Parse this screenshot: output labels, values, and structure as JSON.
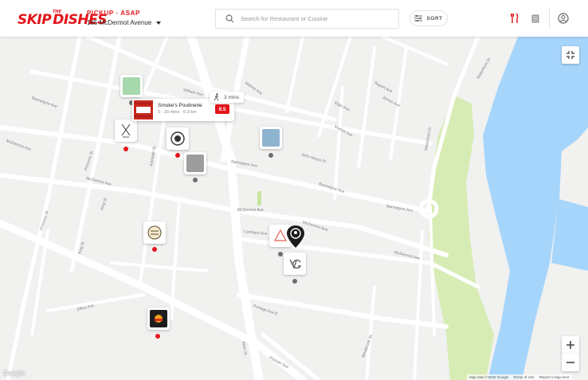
{
  "header": {
    "logo_main": "SKIP",
    "logo_the": "THE",
    "logo_dishes": "DISHES",
    "mode_label": "PICKUP · ASAP",
    "address": "165 McDermot Avenue",
    "search_placeholder": "Search for Restaurant or Cuisine",
    "sort_label": "SORT",
    "brand_color": "#e3151b"
  },
  "map": {
    "streets": {
      "william": "William Ave",
      "market": "Market Ave",
      "elgin": "Elgin Ave",
      "james": "James Ave",
      "bannatyne_left": "Bannatyne Ave",
      "bannatyne_mid": "Bannatyne Ave",
      "bannatyne_right": "Bannatyne Ave",
      "mcdermot_left": "McDermot Ave",
      "mcdermot_mid": "McDermot Ave",
      "mcdermot_right": "McDermot Ave",
      "lombard": "Lombard Ave",
      "portage": "Portage Ave E",
      "pioneer": "Pioneer Ave",
      "ellice": "Ellice Ave",
      "princess": "Princess St",
      "king": "King St",
      "adelaide": "Adelaide St",
      "main": "Main St",
      "waterfront": "Waterfront Dr",
      "rupert": "Rupert Ave",
      "john_hirsch": "John Hirsch Pl",
      "westbrook": "Westbrook St"
    },
    "popup": {
      "name": "Smoke's Poutinerie",
      "meta": "5 - 20 mins  ·  0.3 km",
      "score": "9.5",
      "walk": "3 mins"
    },
    "google_logo": "Google",
    "attribution": [
      "Map data ©2020 Google",
      "Terms of Use",
      "Report a map error"
    ]
  },
  "colors": {
    "water": "#a6d5fb",
    "park": "#d6ecb4",
    "road": "#ffffff",
    "land": "#f1f1f0"
  }
}
